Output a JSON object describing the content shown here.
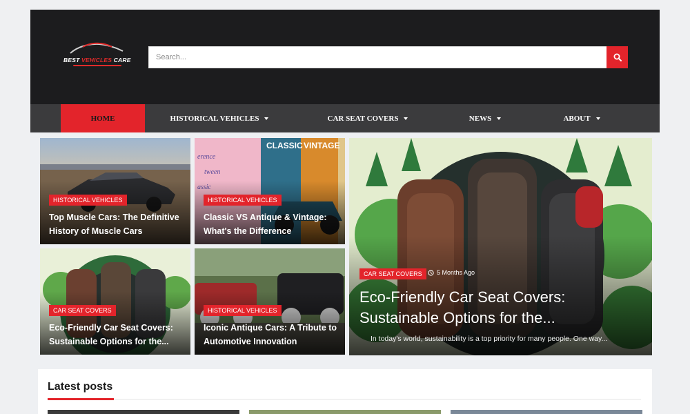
{
  "brand": {
    "logo_word1": "BEST",
    "logo_word2": "VEHICLES",
    "logo_word3": "CARE"
  },
  "search": {
    "placeholder": "Search..."
  },
  "nav": {
    "home": "HOME",
    "historical": "HISTORICAL VEHICLES",
    "seat_covers": "CAR SEAT COVERS",
    "news": "NEWS",
    "about": "ABOUT"
  },
  "grid": {
    "card1": {
      "category": "HISTORICAL VEHICLES",
      "title_line1": "Top Muscle Cars: The Definitive",
      "title_line2": "History of Muscle Cars"
    },
    "card2": {
      "category": "HISTORICAL VEHICLES",
      "title_line1": "Classic VS Antique & Vintage:",
      "title_line2": "What's the Difference",
      "sign1": "CLASSIC",
      "sign2": "VINTAGE"
    },
    "card3": {
      "category": "CAR SEAT COVERS",
      "title_line1": "Eco-Friendly Car Seat Covers:",
      "title_line2": "Sustainable Options for the..."
    },
    "card4": {
      "category": "HISTORICAL VEHICLES",
      "title_line1": "Iconic Antique Cars: A Tribute to",
      "title_line2": "Automotive Innovation"
    },
    "feature": {
      "category": "CAR SEAT COVERS",
      "time": "5 Months Ago",
      "title_line1": "Eco-Friendly Car Seat Covers:",
      "title_line2": "Sustainable Options for the...",
      "excerpt": "In today's world, sustainability is a top priority for many people. One way..."
    }
  },
  "latest": {
    "title": "Latest posts"
  },
  "colors": {
    "accent": "#e3242b",
    "header_bg": "#1c1c1e",
    "nav_bg": "#3b3b3d"
  },
  "icons": {
    "search": "magnifier-icon",
    "clock": "clock-icon",
    "dropdown": "caret-down-icon"
  }
}
